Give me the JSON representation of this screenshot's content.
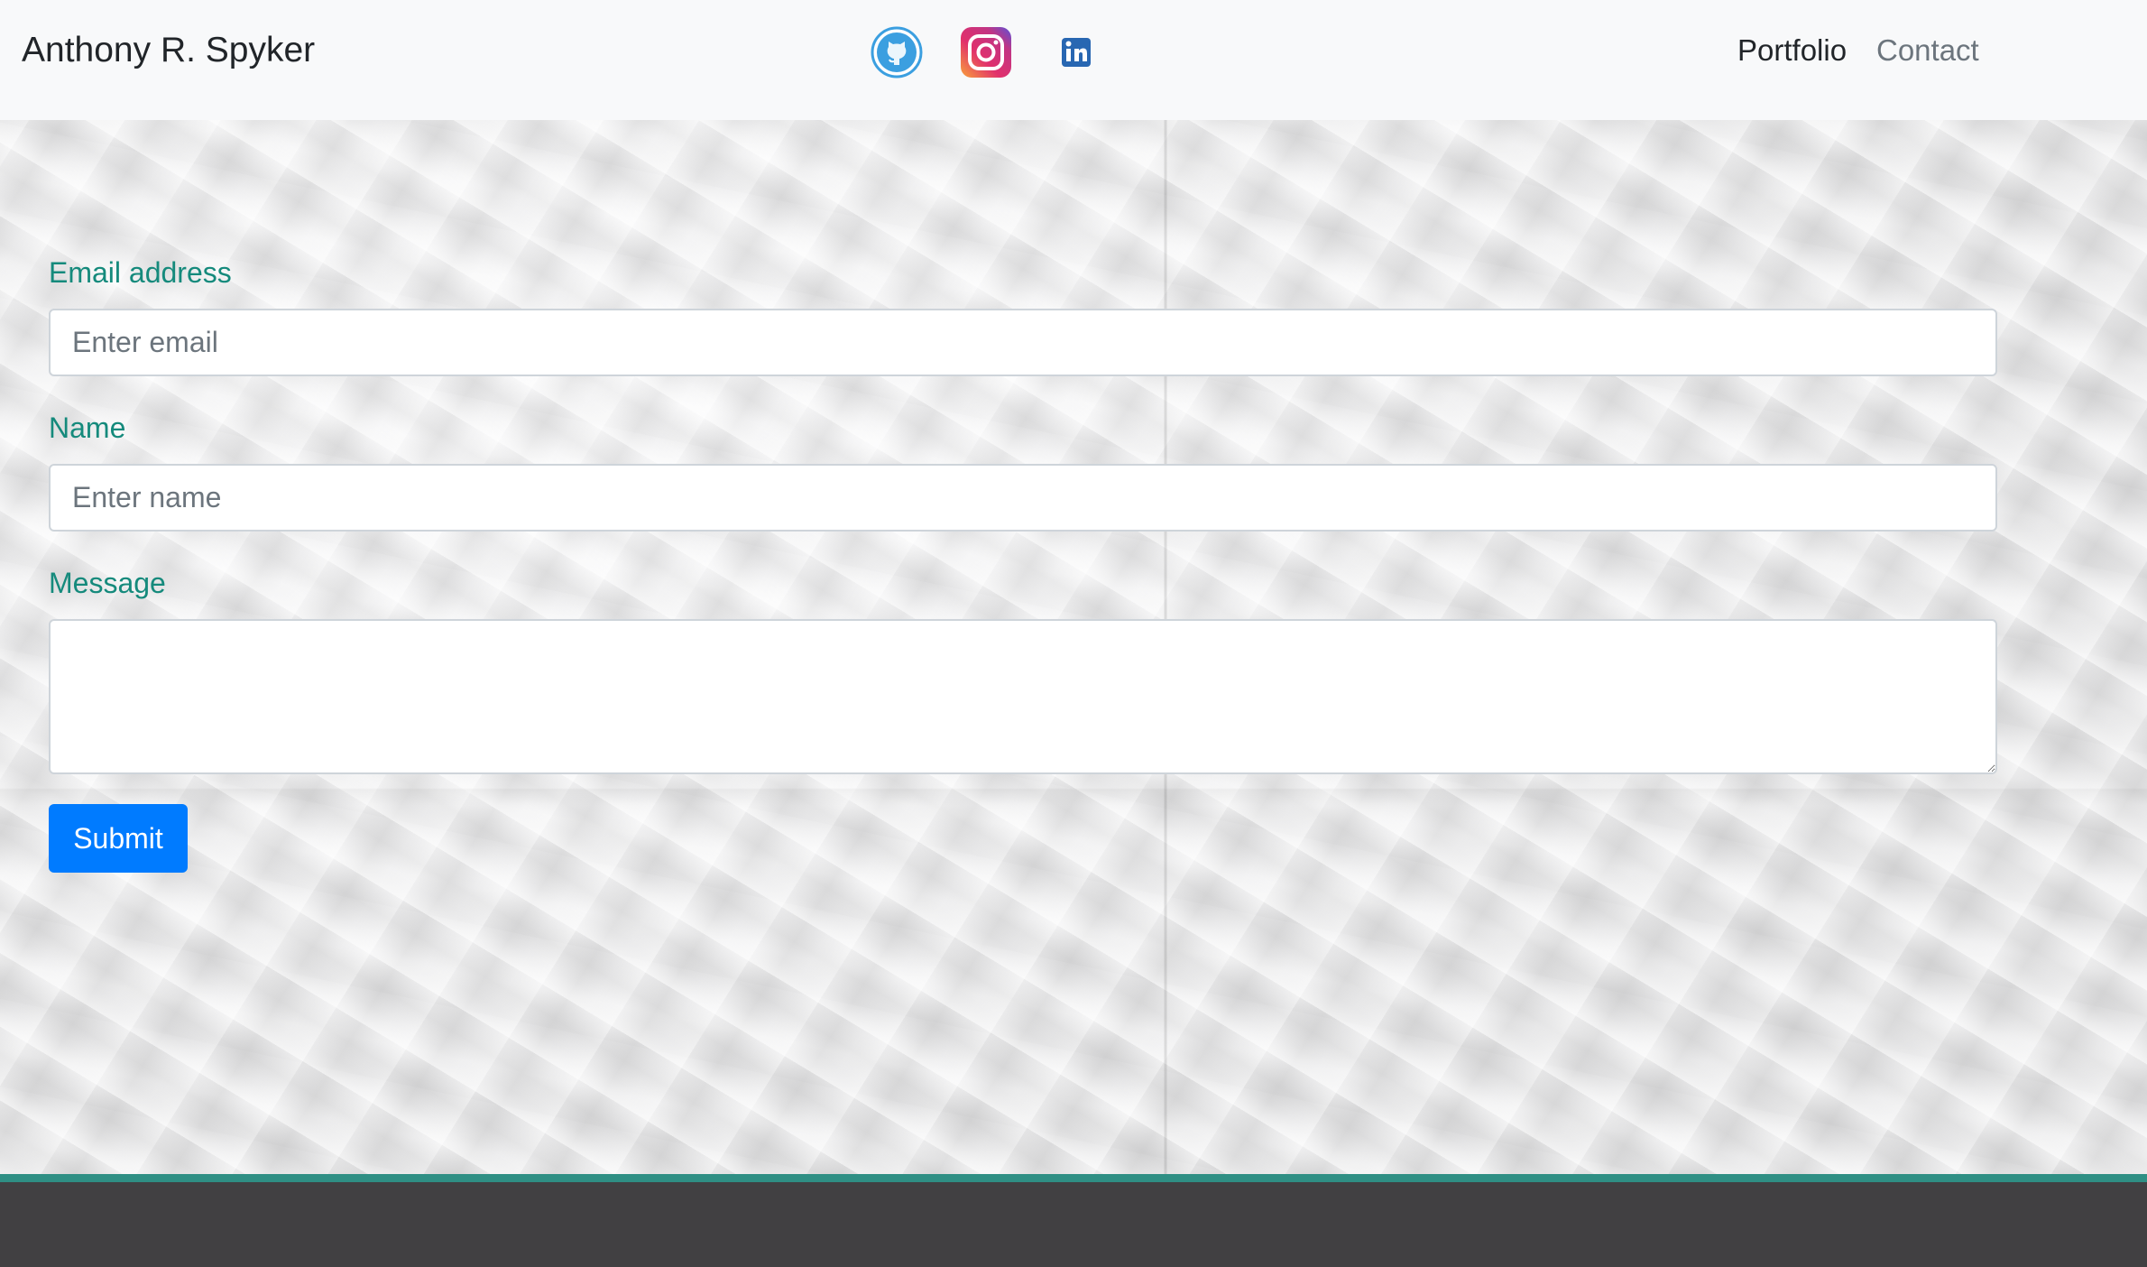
{
  "navbar": {
    "brand": "Anthony R. Spyker",
    "social": [
      {
        "name": "github",
        "icon": "github-icon"
      },
      {
        "name": "instagram",
        "icon": "instagram-icon"
      },
      {
        "name": "linkedin",
        "icon": "linkedin-icon"
      }
    ],
    "links": {
      "portfolio": "Portfolio",
      "contact": "Contact"
    }
  },
  "form": {
    "email": {
      "label": "Email address",
      "placeholder": "Enter email",
      "value": ""
    },
    "name": {
      "label": "Name",
      "placeholder": "Enter name",
      "value": ""
    },
    "message": {
      "label": "Message",
      "placeholder": "",
      "value": ""
    },
    "submit_label": "Submit"
  },
  "colors": {
    "label": "#158a7c",
    "primary": "#007bff",
    "footer": "#414042",
    "footer_accent": "#2f8f84",
    "nav_bg": "#f8f9fa"
  }
}
